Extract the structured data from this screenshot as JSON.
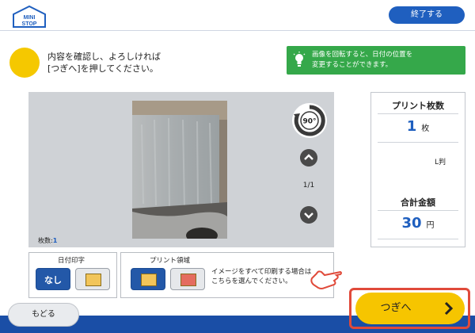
{
  "header": {
    "logo_text": "MINI STOP",
    "end_button": "終了する"
  },
  "instruction": "内容を確認し、よろしければ\n[つぎへ]を押してください。",
  "tip": {
    "icon": "lightbulb-icon",
    "text": "画像を回転すると、日付の位置を\n変更することができます。"
  },
  "preview": {
    "count_label": "枚数:",
    "count_value": "1",
    "rotate_label": "90°",
    "page_indicator": "1/1"
  },
  "options": {
    "date_print": {
      "title": "日付印字",
      "none_label": "なし",
      "selected": "なし"
    },
    "print_area": {
      "title": "プリント領域",
      "note": "イメージをすべて印刷する場合は\nこちらを選んでください。"
    }
  },
  "summary": {
    "print_count_title": "プリント枚数",
    "print_count": "1",
    "print_count_unit": "枚",
    "size": "L判",
    "total_title": "合計金額",
    "total": "30",
    "total_unit": "円"
  },
  "footer": {
    "back_button": "もどる",
    "next_button": "つぎへ"
  },
  "colors": {
    "accent_blue": "#1f5fbf",
    "yellow": "#f6c500",
    "tip_green": "#35a84a",
    "highlight_red": "#e04a3a"
  }
}
